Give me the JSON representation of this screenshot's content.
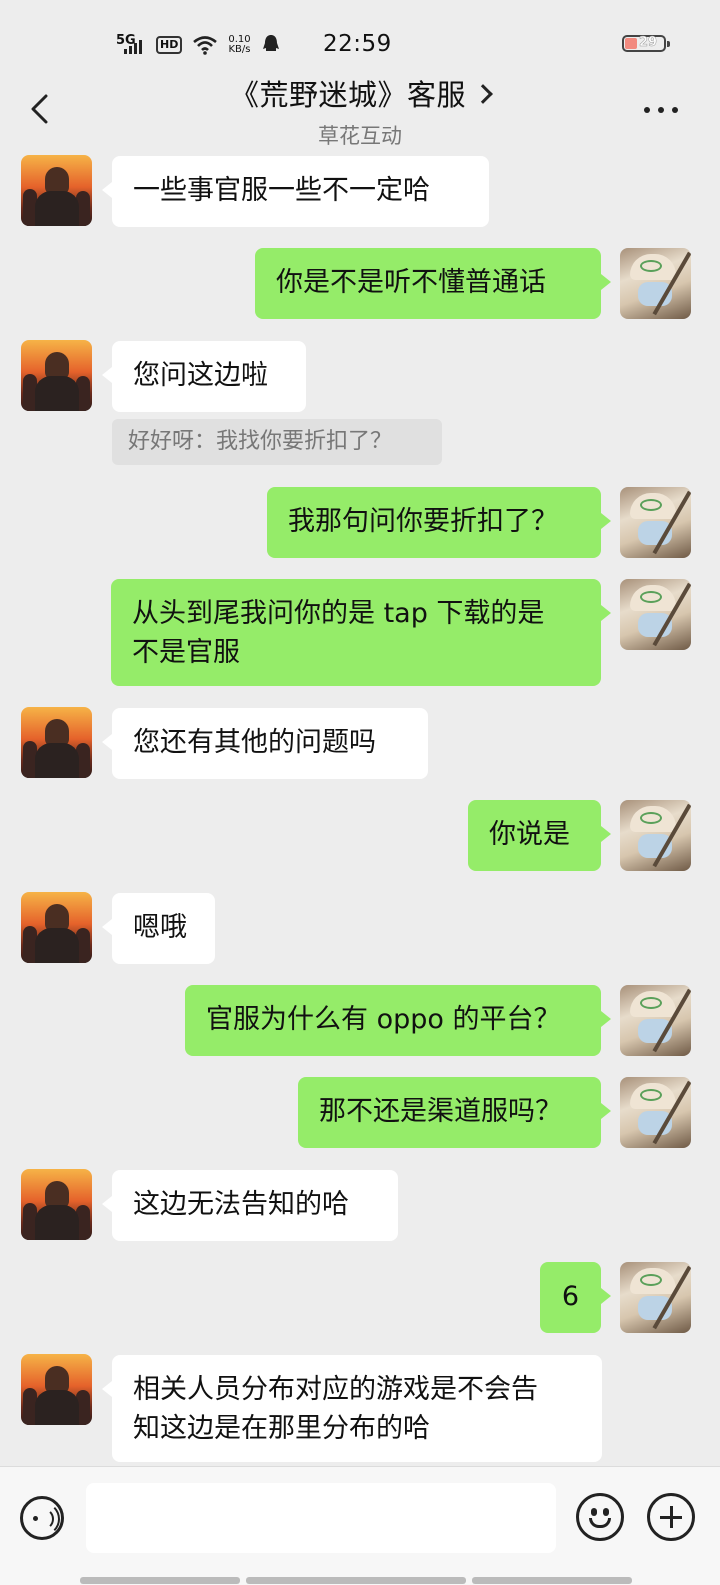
{
  "status_bar": {
    "network": "5G",
    "hd": "HD",
    "speed_value": "0.10",
    "speed_unit": "KB/s",
    "time": "22:59",
    "battery": "29",
    "icons": [
      "signal-icon",
      "wifi-icon",
      "qq-icon",
      "battery-icon"
    ]
  },
  "header": {
    "title": "《荒野迷城》客服",
    "subtitle": "草花互动"
  },
  "messages": [
    {
      "side": "in",
      "text": "一些事官服一些不一定哈"
    },
    {
      "side": "out",
      "text": "你是不是听不懂普通话"
    },
    {
      "side": "in",
      "text": "您问这边啦",
      "quote": "好好呀：我找你要折扣了？"
    },
    {
      "side": "out",
      "text": "我那句问你要折扣了？"
    },
    {
      "side": "out",
      "text": "从头到尾我问你的是 tap 下载的是\n不是官服"
    },
    {
      "side": "in",
      "text": "您还有其他的问题吗"
    },
    {
      "side": "out",
      "text": "你说是"
    },
    {
      "side": "in",
      "text": "嗯哦"
    },
    {
      "side": "out",
      "text": "官服为什么有 oppo 的平台？"
    },
    {
      "side": "out",
      "text": "那不还是渠道服吗？"
    },
    {
      "side": "in",
      "text": "这边无法告知的哈"
    },
    {
      "side": "out",
      "text": "6"
    },
    {
      "side": "in",
      "text": "相关人员分布对应的游戏是不会告\n知这边是在那里分布的哈"
    }
  ],
  "input": {
    "value": "",
    "placeholder": ""
  },
  "colors": {
    "background": "#ededed",
    "incoming_bubble": "#ffffff",
    "outgoing_bubble": "#95ec69",
    "quote_bg": "#e0e0e0"
  }
}
